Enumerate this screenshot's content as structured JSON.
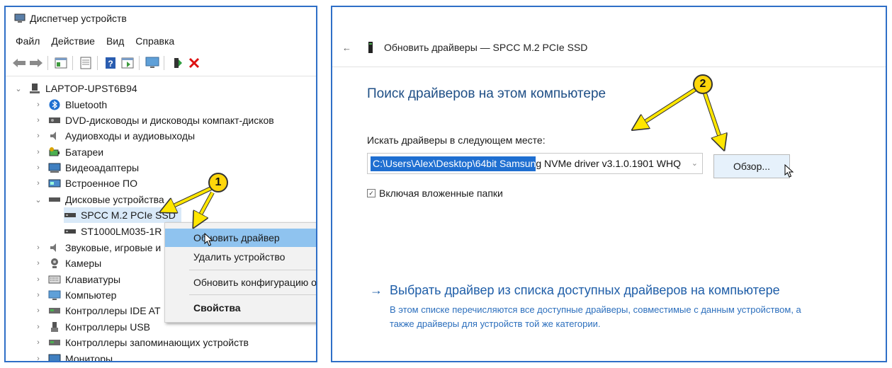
{
  "left_window": {
    "title": "Диспетчер устройств",
    "menu": [
      "Файл",
      "Действие",
      "Вид",
      "Справка"
    ],
    "toolbar_icons": [
      "back-arrow-icon",
      "forward-arrow-icon",
      "properties-icon",
      "list-icon",
      "help-icon",
      "view-icon",
      "monitor-scan-icon",
      "update-driver-icon",
      "remove-icon"
    ],
    "tree": {
      "root": "LAPTOP-UPST6B94",
      "items": [
        {
          "label": "Bluetooth",
          "icon": "bluetooth-icon"
        },
        {
          "label": "DVD-дисководы и дисководы компакт-дисков",
          "icon": "dvd-drive-icon"
        },
        {
          "label": "Аудиовходы и аудиовыходы",
          "icon": "audio-icon"
        },
        {
          "label": "Батареи",
          "icon": "battery-icon"
        },
        {
          "label": "Видеоадаптеры",
          "icon": "display-adapter-icon"
        },
        {
          "label": "Встроенное ПО",
          "icon": "firmware-icon"
        },
        {
          "label": "Дисковые устройства",
          "icon": "disk-drive-icon"
        },
        {
          "label": "SPCC M.2 PCIe SSD",
          "icon": "disk-icon"
        },
        {
          "label": "ST1000LM035-1R",
          "icon": "disk-icon"
        },
        {
          "label": "Звуковые, игровые и",
          "icon": "sound-icon"
        },
        {
          "label": "Камеры",
          "icon": "camera-icon"
        },
        {
          "label": "Клавиатуры",
          "icon": "keyboard-icon"
        },
        {
          "label": "Компьютер",
          "icon": "computer-icon"
        },
        {
          "label": "Контроллеры IDE AT",
          "icon": "ide-controller-icon"
        },
        {
          "label": "Контроллеры USB",
          "icon": "usb-icon"
        },
        {
          "label": "Контроллеры запоминающих устройств",
          "icon": "storage-controller-icon"
        },
        {
          "label": "Мониторы",
          "icon": "monitor-icon"
        }
      ]
    },
    "context_menu": {
      "update": "Обновить драйвер",
      "remove": "Удалить устройство",
      "scan": "Обновить конфигурацию о",
      "properties": "Свойства"
    },
    "badge": "1"
  },
  "right_window": {
    "title": "Обновить драйверы — SPCC M.2 PCIe SSD",
    "heading": "Поиск драйверов на этом компьютере",
    "search_label": "Искать драйверы в следующем месте:",
    "path_selected": "C:\\Users\\Alex\\Desktop\\64bit Samsun",
    "path_rest": "g NVMe driver v3.1.0.1901 WHQ",
    "browse": "Обзор...",
    "include_subfolders": "Включая вложенные папки",
    "link_text": "Выбрать драйвер из списка доступных драйверов на компьютере",
    "link_desc": "В этом списке перечисляются все доступные драйверы, совместимые с данным устройством, а также драйверы для устройств той же категории.",
    "badge": "2"
  },
  "colors": {
    "accent": "#2f6fc7",
    "badge": "#ffd60a",
    "link": "#1f5ea8",
    "selection": "#1f6fd1"
  }
}
